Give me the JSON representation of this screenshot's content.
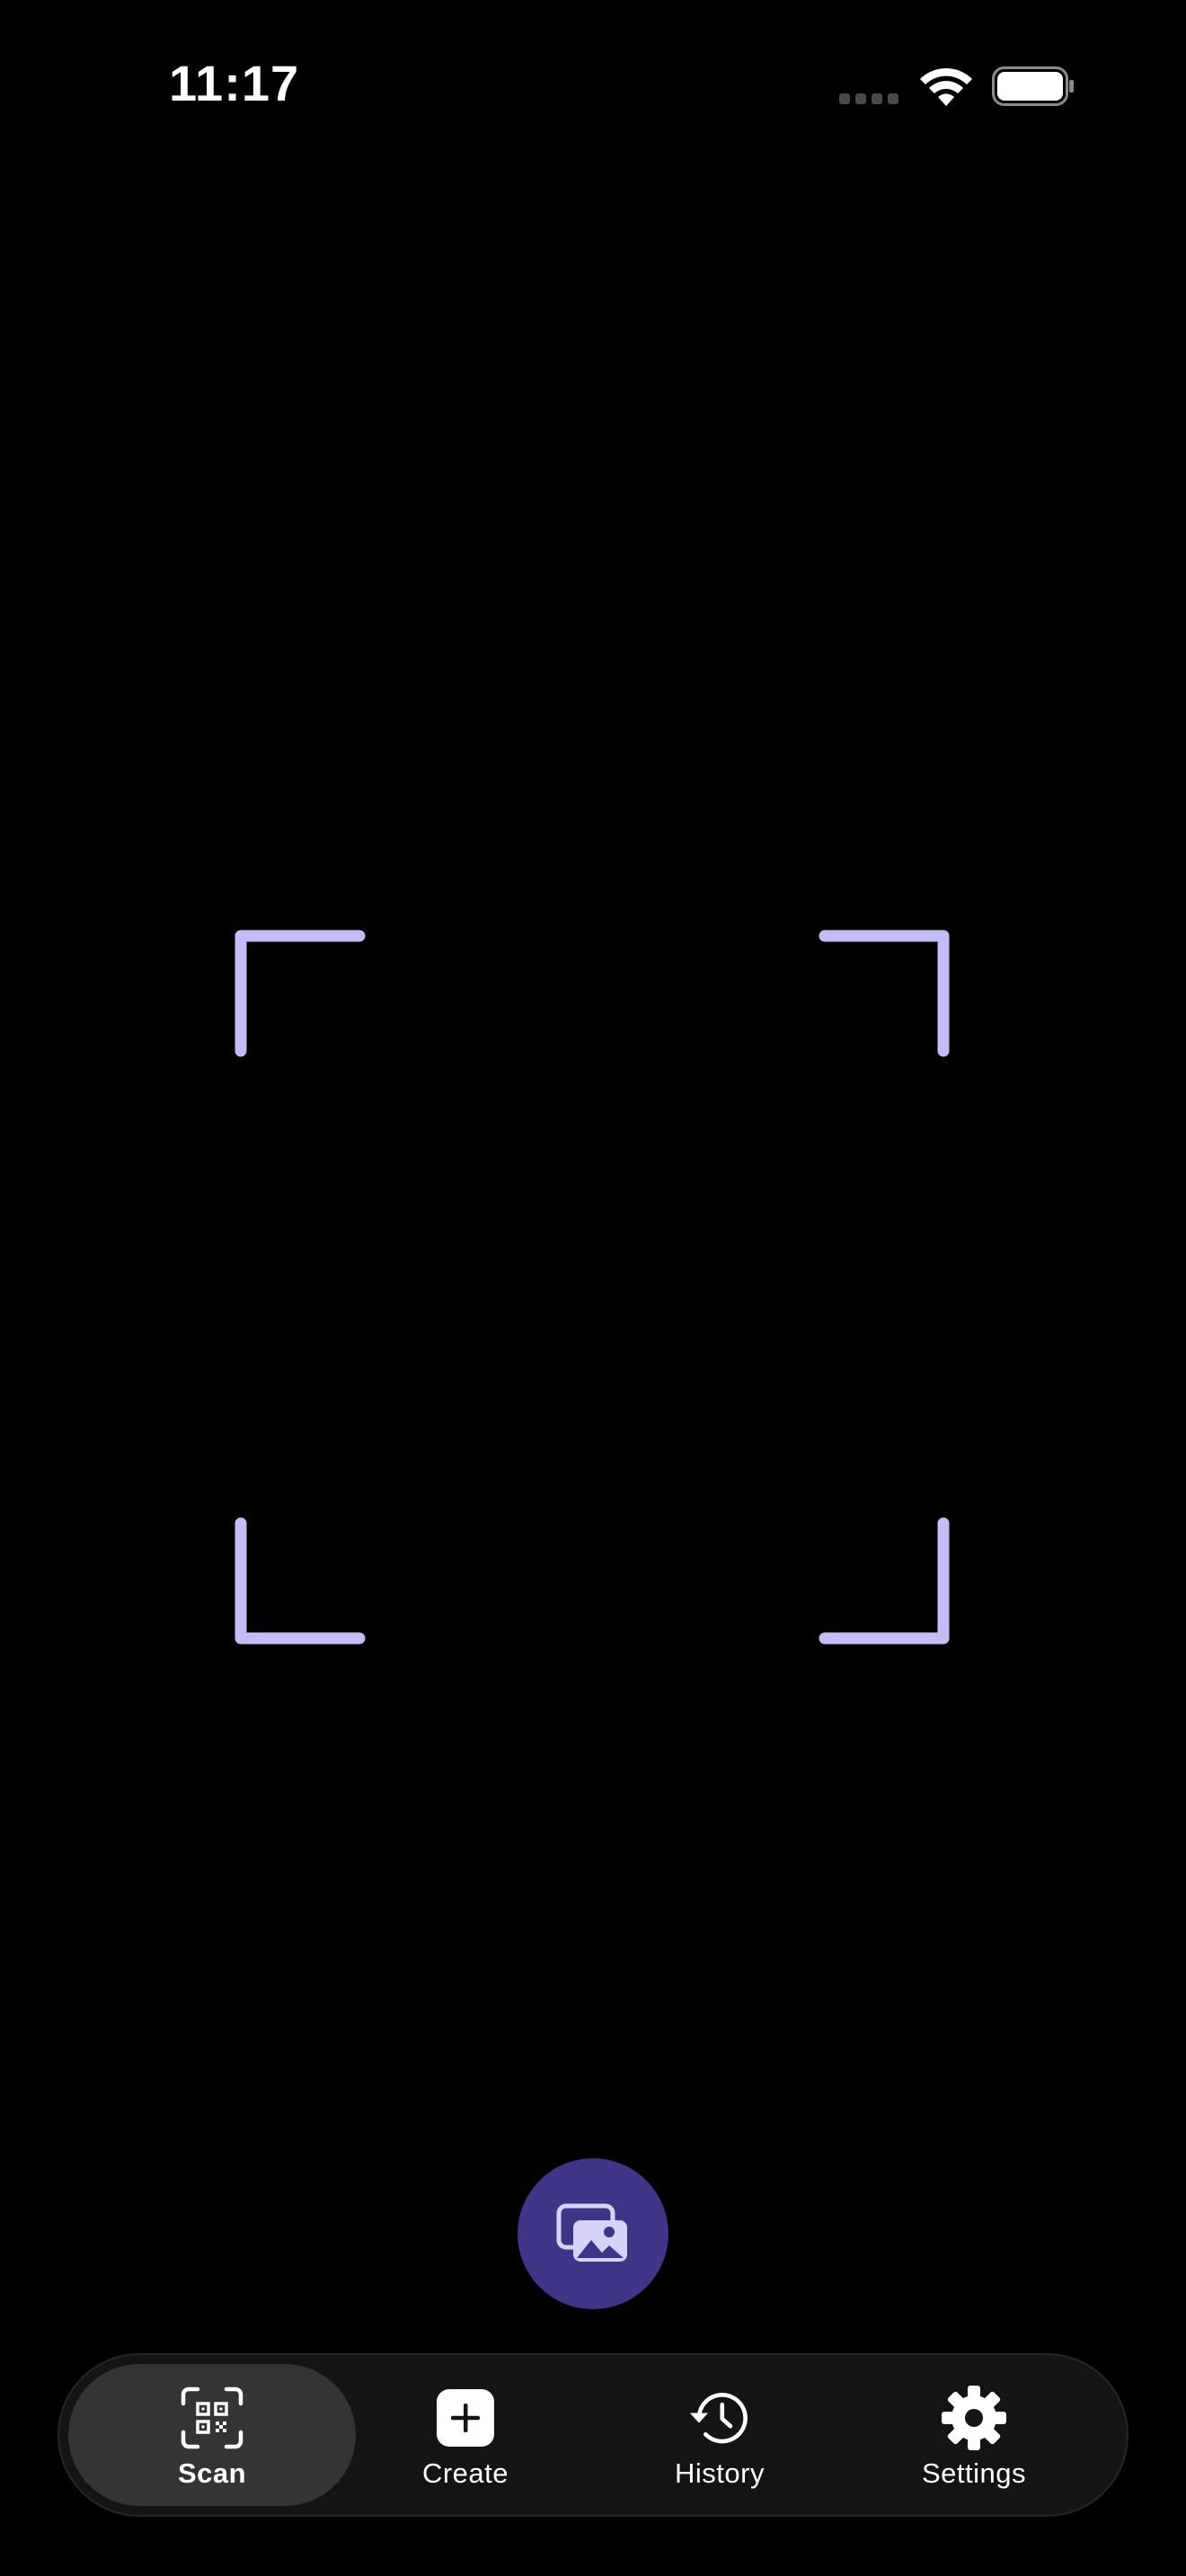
{
  "status_bar": {
    "time": "11:17"
  },
  "colors": {
    "background": "#000000",
    "scan_frame": "#c2bdf7",
    "gallery_button": "#3e3586",
    "tab_bar": "#141414",
    "tab_active": "#343434"
  },
  "gallery_button": {
    "icon": "photo-library-icon"
  },
  "tabs": [
    {
      "label": "Scan",
      "icon": "qr-scan-icon",
      "active": true
    },
    {
      "label": "Create",
      "icon": "plus-square-icon",
      "active": false
    },
    {
      "label": "History",
      "icon": "history-clock-icon",
      "active": false
    },
    {
      "label": "Settings",
      "icon": "gear-icon",
      "active": false
    }
  ]
}
